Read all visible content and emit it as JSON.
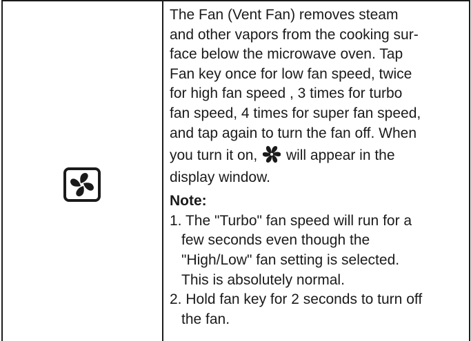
{
  "icon_cell": {
    "icon": "fan-key-icon"
  },
  "description": {
    "lines": [
      "The Fan (Vent Fan) removes steam",
      "and other vapors from the cooking sur-",
      "face below the microwave oven. Tap",
      "Fan key once for low fan speed, twice",
      "for high fan speed , 3 times for turbo",
      "fan speed, 4 times for super fan speed,",
      "and tap again to turn the fan off. When"
    ],
    "inline_before": "you turn it on,",
    "inline_icon": "fan-indicator-icon",
    "inline_after": "will appear in the",
    "last_line": "display window."
  },
  "note": {
    "heading": "Note:",
    "items": [
      {
        "lines": [
          "1. The \"Turbo\" fan speed will run for a",
          "few seconds even though the",
          "\"High/Low\" fan setting is selected.",
          "This is absolutely normal."
        ]
      },
      {
        "lines": [
          "2. Hold fan key for 2 seconds to turn off",
          "the fan."
        ]
      }
    ]
  }
}
